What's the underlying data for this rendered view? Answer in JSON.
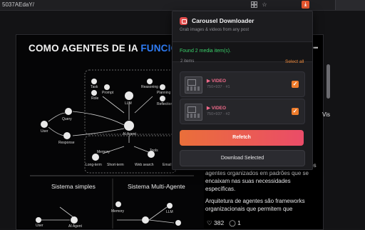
{
  "browser": {
    "url_fragment": "5037AEdaY/",
    "toolbar_icons": [
      "extensions-icon",
      "bookmark-star-icon",
      "profile-icon"
    ]
  },
  "infographic": {
    "title_prefix": "COMO AGENTES DE IA ",
    "title_highlight": "FUNCION",
    "nodes": {
      "user": "User",
      "query": "Query",
      "response": "Response",
      "task": "Task",
      "prompt": "Prompt",
      "role": "Role",
      "llm": "LLM",
      "reasoning": "Reasoning",
      "planning": "Planning",
      "reflection": "Reflection",
      "ai_agent": "AI Agent",
      "memory": "Memory",
      "long_term": "Long-term",
      "short_term": "Short-term",
      "tools": "Tools",
      "web_search": "Web search",
      "email": "Email"
    },
    "section_simple": "Sistema simples",
    "section_multi": "Sistema Multi-Agente",
    "bottom_nodes": {
      "memory": "Memory",
      "user": "User",
      "ai_agent": "AI Agent",
      "llm": "LLM"
    }
  },
  "post": {
    "side_clip": "Vis",
    "body_1": "de IA totalmente integrado usando múltiplos agentes organizados em padrões que se encaixam nas suas necessidades específicas.",
    "body_2": "Arquitetura de agentes são frameworks organizacionais que permitem que",
    "likes": "382",
    "comments": "1"
  },
  "popup": {
    "title": "Carousel Downloader",
    "subtitle": "Grab images & videos from any post",
    "found_text": "Found 2 media item(s).",
    "items_count": "2 items",
    "select_all": "Select all",
    "items": [
      {
        "type": "▶ VIDEO",
        "meta": "750×937 · #1",
        "checked": true
      },
      {
        "type": "▶ VIDEO",
        "meta": "750×937 · #2",
        "checked": true
      }
    ],
    "refetch_label": "Refetch",
    "download_label": "Download Selected"
  },
  "colors": {
    "accent_orange": "#ee7c2c",
    "success_green": "#3ad06a",
    "video_pink": "#f06a8a",
    "title_blue": "#2f7df6"
  }
}
